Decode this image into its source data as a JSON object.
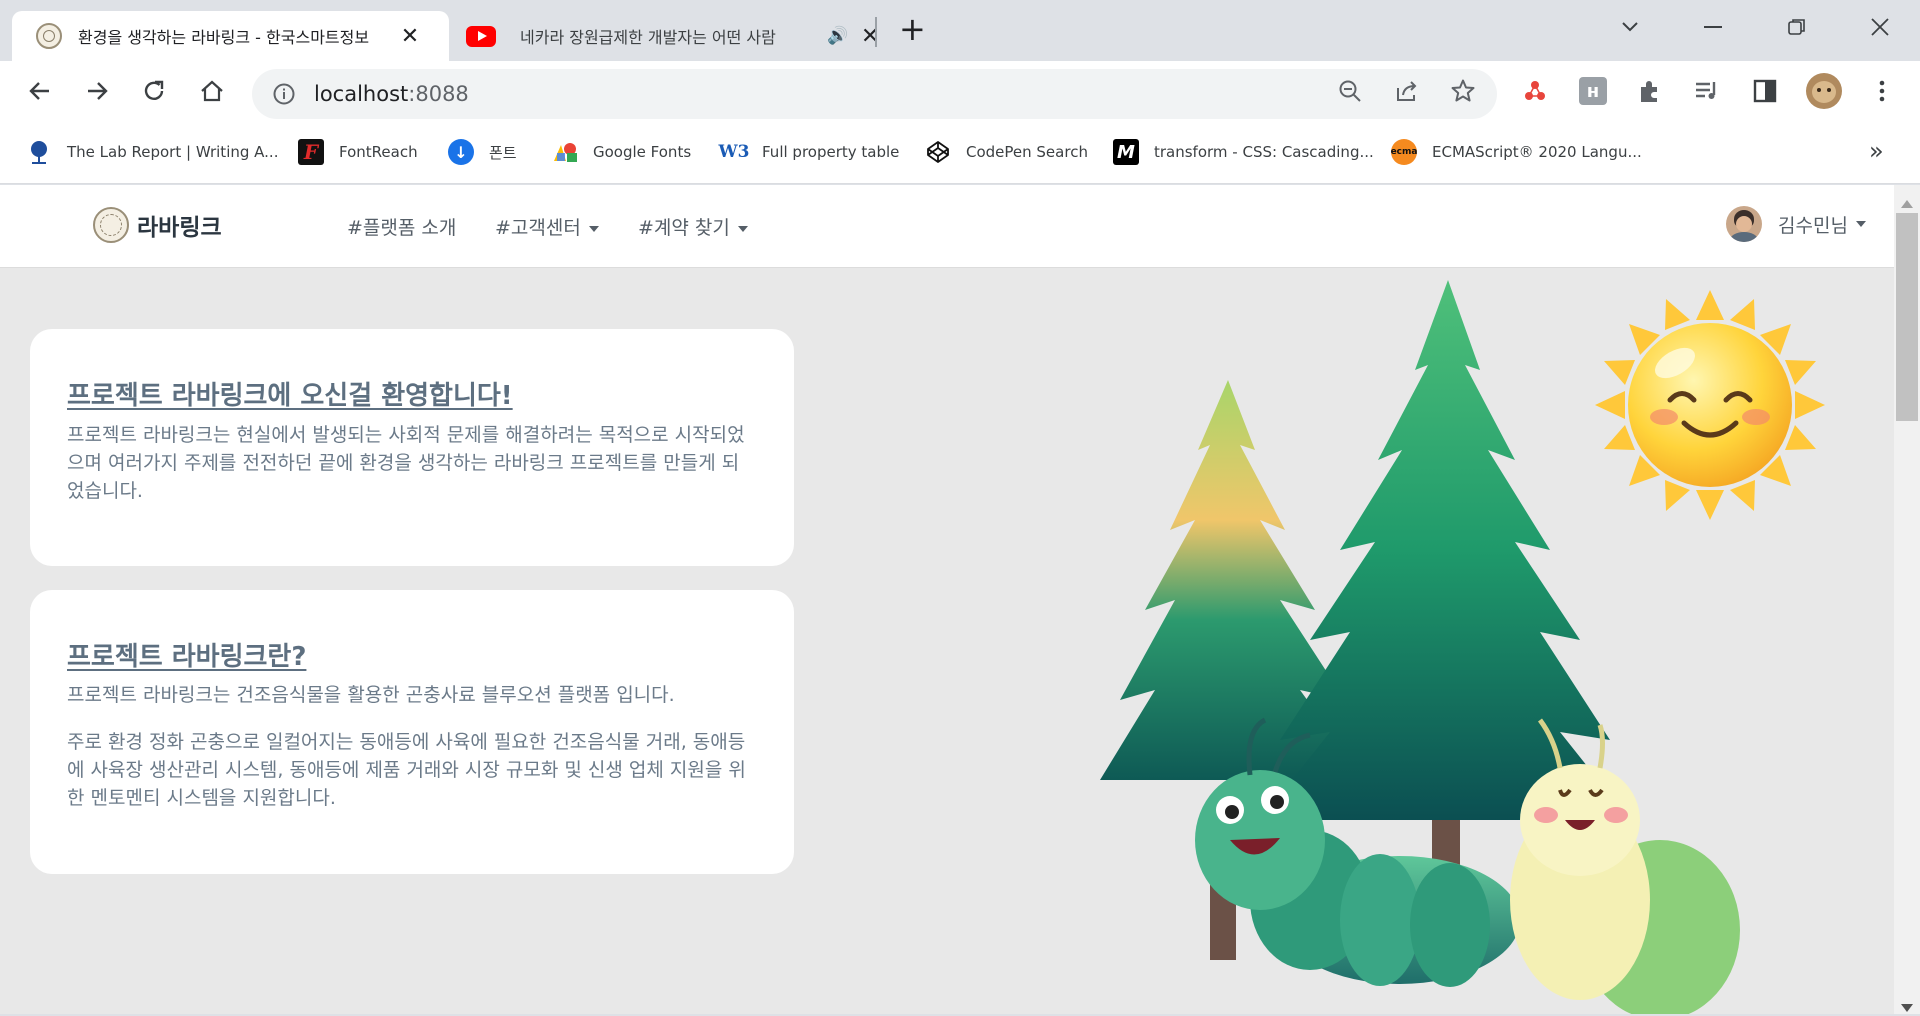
{
  "browser": {
    "tabs": [
      {
        "title": "환경을 생각하는 라바링크 - 한국스마트정보",
        "favicon": "labalink-seal-icon",
        "active": true,
        "close": "✕"
      },
      {
        "title": "네카라 장원급제한 개발자는 어떤 사람",
        "favicon": "youtube-icon",
        "active": false,
        "audio": "🔊",
        "close": "✕"
      }
    ],
    "new_tab": "+",
    "url_host": "localhost",
    "url_port": ":8088",
    "bookmarks": [
      {
        "label": "The Lab Report | Writing A...",
        "icon": "tree-icon",
        "color": "#1f4e9c"
      },
      {
        "label": "FontReach",
        "icon": "fontreach-icon",
        "color": "#c0121b",
        "glyph": "F"
      },
      {
        "label": "폰트",
        "icon": "download-arrow-icon",
        "color": "#1a73e8",
        "glyph": "↓"
      },
      {
        "label": "Google Fonts",
        "icon": "google-fonts-icon",
        "color": "#34a853"
      },
      {
        "label": "Full property table",
        "icon": "w3-icon",
        "color": "#1a5bb5",
        "glyph": "W3"
      },
      {
        "label": "CodePen Search",
        "icon": "codepen-icon",
        "color": "#111111"
      },
      {
        "label": "transform - CSS: Cascading...",
        "icon": "mdn-icon",
        "color": "#000000",
        "glyph": "M"
      },
      {
        "label": "ECMAScript® 2020 Langu...",
        "icon": "ecma-icon",
        "color": "#f58a1f",
        "glyph": "ecma"
      }
    ],
    "bookmarks_overflow": "»"
  },
  "site": {
    "brand": "라바링크",
    "menu": [
      {
        "label": "#플랫폼 소개",
        "dropdown": false
      },
      {
        "label": "#고객센터",
        "dropdown": true
      },
      {
        "label": "#계약 찾기",
        "dropdown": true
      }
    ],
    "user_name": "김수민님"
  },
  "cards": [
    {
      "title": "프로젝트 라바링크에 오신걸 환영합니다!",
      "paragraphs": [
        "프로젝트 라바링크는 현실에서 발생되는 사회적 문제를 해결하려는 목적으로 시작되었으며 여러가지 주제를 전전하던 끝에 환경을 생각하는 라바링크 프로젝트를 만들게 되었습니다."
      ]
    },
    {
      "title": "프로젝트 라바링크란?",
      "paragraphs": [
        "프로젝트 라바링크는 건조음식물을 활용한 곤충사료 블루오션 플랫폼 입니다.",
        "주로 환경 정화 곤충으로 일컬어지는 동애등에 사육에 필요한 건조음식물 거래, 동애등에 사육장 생산관리 시스템, 동애등에 제품 거래와 시장 규모화 및 신생 업체 지원을 위한 멘토멘티 시스템을 지원합니다."
      ]
    }
  ],
  "colors": {
    "tree_dark": "#0e5a55",
    "tree_mid": "#1f9a6b",
    "tree_light": "#7fcf7a",
    "sun": "#ffd43b",
    "larva_green": "#2f9a7a",
    "larva_cream": "#f4f0b4"
  }
}
